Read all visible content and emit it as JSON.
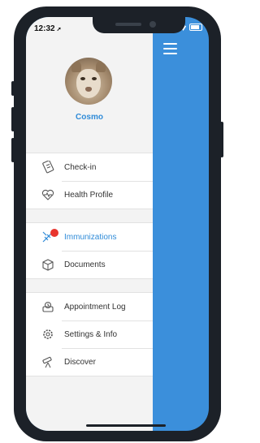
{
  "status_bar": {
    "time": "12:32",
    "location_arrow": "➚"
  },
  "profile": {
    "name": "Cosmo"
  },
  "menu": {
    "sections": [
      [
        {
          "label": "Check-in",
          "icon": "checkin-icon"
        },
        {
          "label": "Health Profile",
          "icon": "health-heart-icon"
        }
      ],
      [
        {
          "label": "Immunizations",
          "icon": "immunizations-icon",
          "active": true,
          "badge": true
        },
        {
          "label": "Documents",
          "icon": "documents-icon"
        }
      ],
      [
        {
          "label": "Appointment Log",
          "icon": "appointment-log-icon"
        },
        {
          "label": "Settings & Info",
          "icon": "gear-icon"
        },
        {
          "label": "Discover",
          "icon": "telescope-icon"
        }
      ]
    ]
  },
  "colors": {
    "accent": "#2f8bd8",
    "panel": "#3b8fdb",
    "badge": "#e8352e",
    "phone": "#1c2128"
  }
}
